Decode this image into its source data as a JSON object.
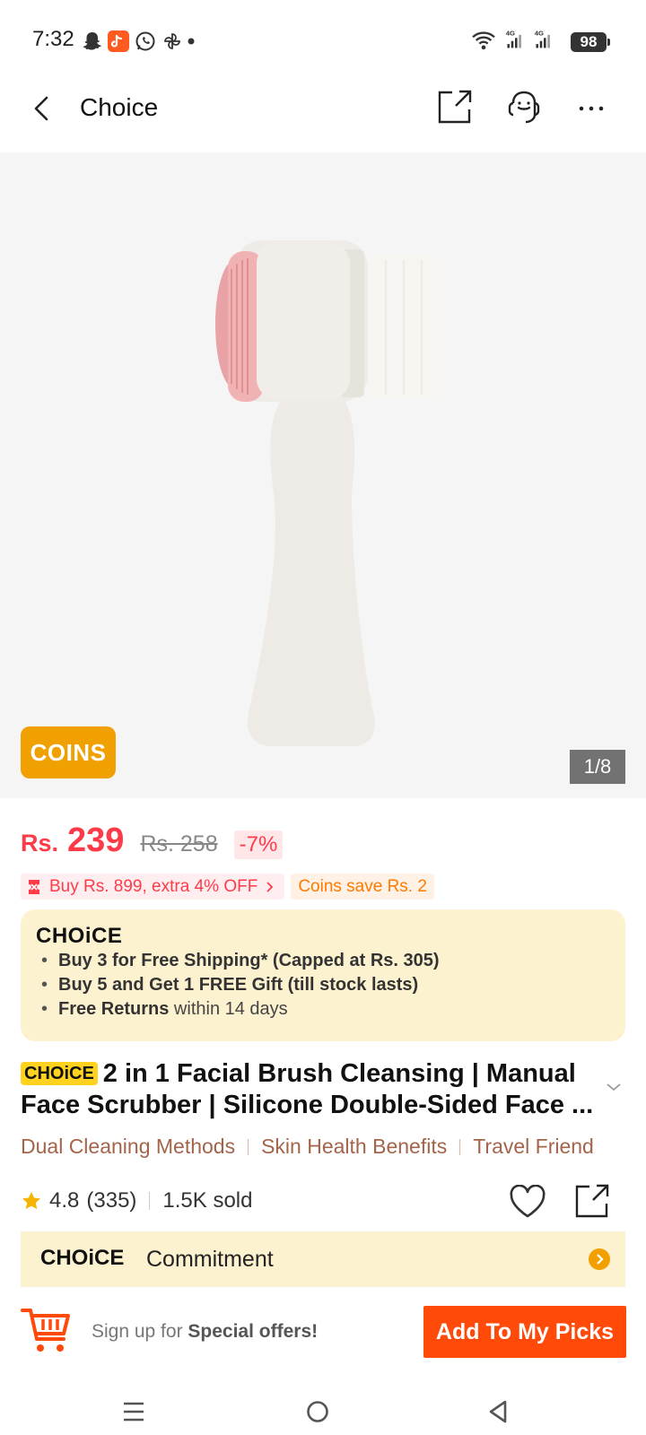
{
  "status_bar": {
    "time": "7:32",
    "battery": "98"
  },
  "header": {
    "title": "Choice"
  },
  "gallery": {
    "coins_badge": "COINS",
    "counter": "1/8"
  },
  "price": {
    "currency": "Rs.",
    "current": "239",
    "original": "Rs. 258",
    "discount": "-7%"
  },
  "promos": {
    "deal": "Buy Rs. 899, extra 4% OFF",
    "coins": "Coins save Rs. 2"
  },
  "choice_box": {
    "logo": "CHOiCE",
    "bullets": [
      {
        "bold": "Buy 3 for  Free Shipping* (Capped at Rs. 305)",
        "rest": ""
      },
      {
        "bold": "Buy 5 and Get 1 FREE Gift (till stock lasts)",
        "rest": ""
      },
      {
        "bold": "Free Returns",
        "rest": " within 14 days"
      }
    ]
  },
  "product": {
    "badge": "CHOiCE",
    "title": "2 in 1 Facial Brush Cleansing | Manual Face Scrubber | Silicone Double-Sided Face ...",
    "features": [
      "Dual Cleaning Methods",
      "Skin Health Benefits",
      "Travel Friend"
    ]
  },
  "rating": {
    "score": "4.8",
    "count": "(335)",
    "sold": "1.5K sold"
  },
  "commitment": {
    "logo": "CHOiCE",
    "label": "Commitment"
  },
  "bottom_bar": {
    "signup_prefix": "Sign up for ",
    "signup_bold": "Special offers!",
    "cta": "Add To My Picks"
  },
  "colors": {
    "price_red": "#ff3b4a",
    "brand_orange": "#ff4a0a",
    "coins_gold": "#f0a000",
    "choice_cream": "#fdf2cf",
    "feature_brown": "#a4644a"
  }
}
